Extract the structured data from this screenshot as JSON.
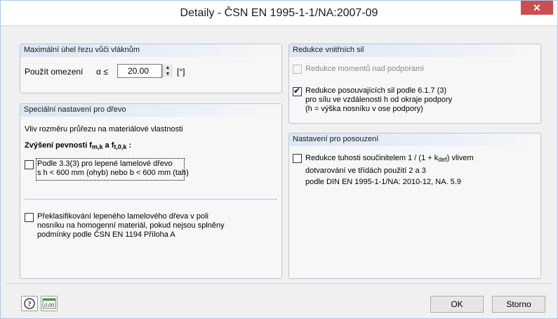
{
  "window": {
    "title": "Detaily - ČSN EN 1995-1-1/NA:2007-09",
    "close_glyph": "✕"
  },
  "angle_group": {
    "header": "Maximální úhel řezu vůči vláknům",
    "use_limit_label": "Použít omezení",
    "alpha_symbol": "α ≤",
    "value": "20.00",
    "unit": "[°]"
  },
  "wood_group": {
    "header": "Speciální nastavení pro dřevo",
    "size_influence": "Vliv rozměru průřezu na materiálové vlastnosti",
    "strength_increase_prefix": "Zvýšení pevnosti f",
    "strength_sub1": "m,k",
    "strength_mid": " a  f",
    "strength_sub2": "t,0,k",
    "strength_suffix": " :",
    "option1_line1": "Podle 3.3(3) pro lepené lamelové dřevo",
    "option1_line2": "s h < 600 mm (ohyb) nebo b < 600 mm (tah)",
    "option1_checked": false,
    "option2_line1": "Překlasifikování lepeného lamelového dřeva v poli",
    "option2_line2": "nosníku na homogenní materiál, pokud nejsou splněny",
    "option2_line3": "podmínky podle ČSN EN 1194 Příloha A",
    "option2_checked": false
  },
  "forces_group": {
    "header": "Redukce vnitřních sil",
    "moments_label": "Redukce momentů nad podporami",
    "moments_checked": false,
    "moments_enabled": false,
    "shear_line1": "Redukce posouvajících sil podle 6.1.7 (3)",
    "shear_line2": "pro sílu ve vzdálenosti h od okraje podpory",
    "shear_line3": "(h = výška nosníku v ose podpory)",
    "shear_checked": true
  },
  "assessment_group": {
    "header": "Nastavení pro posouzení",
    "stiffness_line1_prefix": "Redukce tuhosti součinitelem 1 / (1 + k",
    "stiffness_sub": "def",
    "stiffness_line1_suffix": ") vlivem",
    "stiffness_line2": "dotvarování ve třídách použití 2 a 3",
    "stiffness_line3": "podle DIN EN 1995-1-1/NA: 2010-12, NA. 5.9",
    "stiffness_checked": false
  },
  "footer": {
    "help_icon_glyph": "?",
    "units_icon_text": "0.00",
    "ok_label": "OK",
    "cancel_label": "Storno"
  }
}
